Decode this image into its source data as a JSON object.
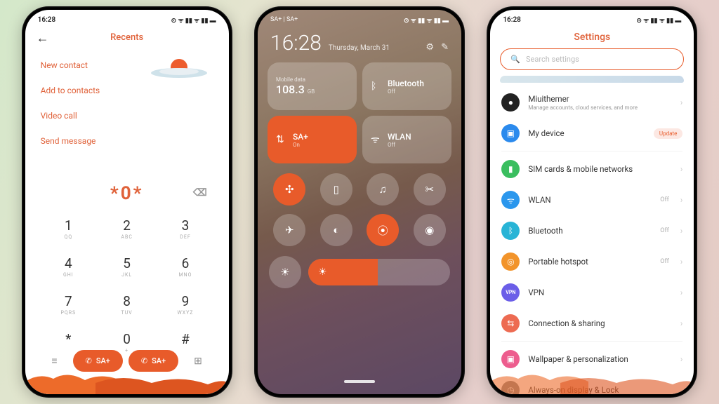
{
  "status": {
    "time": "16:28",
    "icons": "⊙ ᯤ ▮▮ ᯤ ▮▮ ▬"
  },
  "phone1": {
    "header": "Recents",
    "menu": [
      "New contact",
      "Add to contacts",
      "Video call",
      "Send message"
    ],
    "dialed": "*0*",
    "keys": [
      {
        "n": "1",
        "s": "QQ"
      },
      {
        "n": "2",
        "s": "ABC"
      },
      {
        "n": "3",
        "s": "DEF"
      },
      {
        "n": "4",
        "s": "GHI"
      },
      {
        "n": "5",
        "s": "JKL"
      },
      {
        "n": "6",
        "s": "MNO"
      },
      {
        "n": "7",
        "s": "PQRS"
      },
      {
        "n": "8",
        "s": "TUV"
      },
      {
        "n": "9",
        "s": "WXYZ"
      },
      {
        "n": "*",
        "s": ""
      },
      {
        "n": "0",
        "s": "+"
      },
      {
        "n": "#",
        "s": ""
      }
    ],
    "sim": "SA+"
  },
  "phone2": {
    "carrier": "SA+ | SA+",
    "time": "16:28",
    "date": "Thursday, March 31",
    "tiles": {
      "data": {
        "label": "Mobile data",
        "value": "108.3",
        "unit": "GB"
      },
      "bt": {
        "label": "Bluetooth",
        "value": "Off"
      },
      "sim": {
        "label": "SA+",
        "value": "On"
      },
      "wlan": {
        "label": "WLAN",
        "value": "Off"
      }
    }
  },
  "phone3": {
    "title": "Settings",
    "search_ph": "Search settings",
    "account": {
      "name": "Miuithemer",
      "desc": "Manage accounts, cloud services, and more"
    },
    "update_badge": "Update",
    "items": {
      "device": "My device",
      "sim": "SIM cards & mobile networks",
      "wlan": "WLAN",
      "bt": "Bluetooth",
      "hotspot": "Portable hotspot",
      "vpn": "VPN",
      "share": "Connection & sharing",
      "wallpaper": "Wallpaper & personalization",
      "aod": "Always-on display & Lock"
    },
    "off": "Off"
  }
}
